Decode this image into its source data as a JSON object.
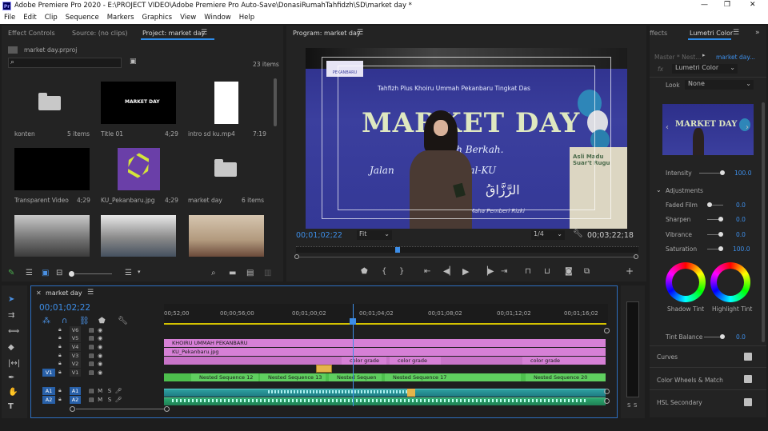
{
  "window": {
    "title": "Adobe Premiere Pro 2020 - E:\\PROJECT VIDEO\\Adobe Premiere Pro Auto-Save\\DonasiRumahTahfidzh\\SD\\market day *",
    "app_badge": "Pr",
    "controls": [
      "—",
      "❐",
      "✕"
    ]
  },
  "menu": [
    "File",
    "Edit",
    "Clip",
    "Sequence",
    "Markers",
    "Graphics",
    "View",
    "Window",
    "Help"
  ],
  "project_panel": {
    "tabs": [
      "Effect Controls",
      "Source: (no clips)",
      "Project: market day"
    ],
    "project_file": "market day.prproj",
    "search_placeholder": "",
    "item_count": "23 items",
    "items": [
      {
        "name": "konten",
        "meta": "5 items",
        "kind": "folder"
      },
      {
        "name": "Title 01",
        "meta": "4;29",
        "kind": "title",
        "thumb_text": "MARKET DAY"
      },
      {
        "name": "intro sd ku.mp4",
        "meta": "7:19",
        "kind": "white"
      },
      {
        "name": "Transparent Video",
        "meta": "4;29",
        "kind": "black"
      },
      {
        "name": "KU_Pekanbaru.jpg",
        "meta": "4;29",
        "kind": "logo"
      },
      {
        "name": "market day",
        "meta": "6 items",
        "kind": "folder"
      }
    ]
  },
  "program_monitor": {
    "tab": "Program: market day",
    "timecode": "00;01;02;22",
    "fit": "Fit",
    "resolution": "1/4",
    "duration": "00;03;22;18",
    "banner_line1": "Tahfizh Plus Khoiru Ummah Pekanbaru Tingkat Das",
    "banner_title": "MARKET DAY",
    "banner_line2": "olah Berkah.",
    "banner_line3": "Jalan          Rizki Halal-KU",
    "banner_arabic": "الرَّزَّاقُ",
    "banner_line4": "Maha Pemberi Rizki",
    "right_sign": "Asli Madu\nSuar't Rugu",
    "logo_text": "PEKANBARU"
  },
  "lumetri": {
    "tabs": [
      "ffects",
      "Lumetri Color"
    ],
    "master_label": "Master * Nest...",
    "clip_label": "market day...",
    "fx_select": "Lumetri Color",
    "look_label": "Look",
    "look_value": "None",
    "preview_title": "MARKET DAY",
    "intensity_label": "Intensity",
    "intensity_value": "100.0",
    "adjustments_label": "Adjustments",
    "adjustments": [
      {
        "label": "Faded Film",
        "value": "0.0"
      },
      {
        "label": "Sharpen",
        "value": "0.0"
      },
      {
        "label": "Vibrance",
        "value": "0.0"
      },
      {
        "label": "Saturation",
        "value": "100.0"
      }
    ],
    "shadow_tint": "Shadow Tint",
    "highlight_tint": "Highlight Tint",
    "tint_balance_label": "Tint Balance",
    "tint_balance_value": "0.0",
    "sections": [
      "Curves",
      "Color Wheels & Match",
      "HSL Secondary"
    ]
  },
  "timeline": {
    "tab": "market day",
    "timecode": "00;01;02;22",
    "ruler": [
      "00;52;00",
      "00;00;56;00",
      "00;01;00;02",
      "00;01;04;02",
      "00;01;08;02",
      "00;01;12;02",
      "00;01;16;02"
    ],
    "video_tracks": [
      "V6",
      "V5",
      "V4",
      "V3",
      "V2",
      "V1"
    ],
    "audio_tracks": [
      "A1",
      "A2"
    ],
    "clip_v5": "KHOIRU UMMAH PEKANBARU",
    "clip_v4": "KU_Pekanbaru.jpg",
    "color_grade": "color grade",
    "nested": [
      "Nested Sequence 12",
      "Nested Sequence 13",
      "Nested Sequen",
      "Nested Sequence 17",
      "Nested Sequence 20"
    ],
    "audio_meter_labels": [
      "S",
      "S"
    ]
  }
}
